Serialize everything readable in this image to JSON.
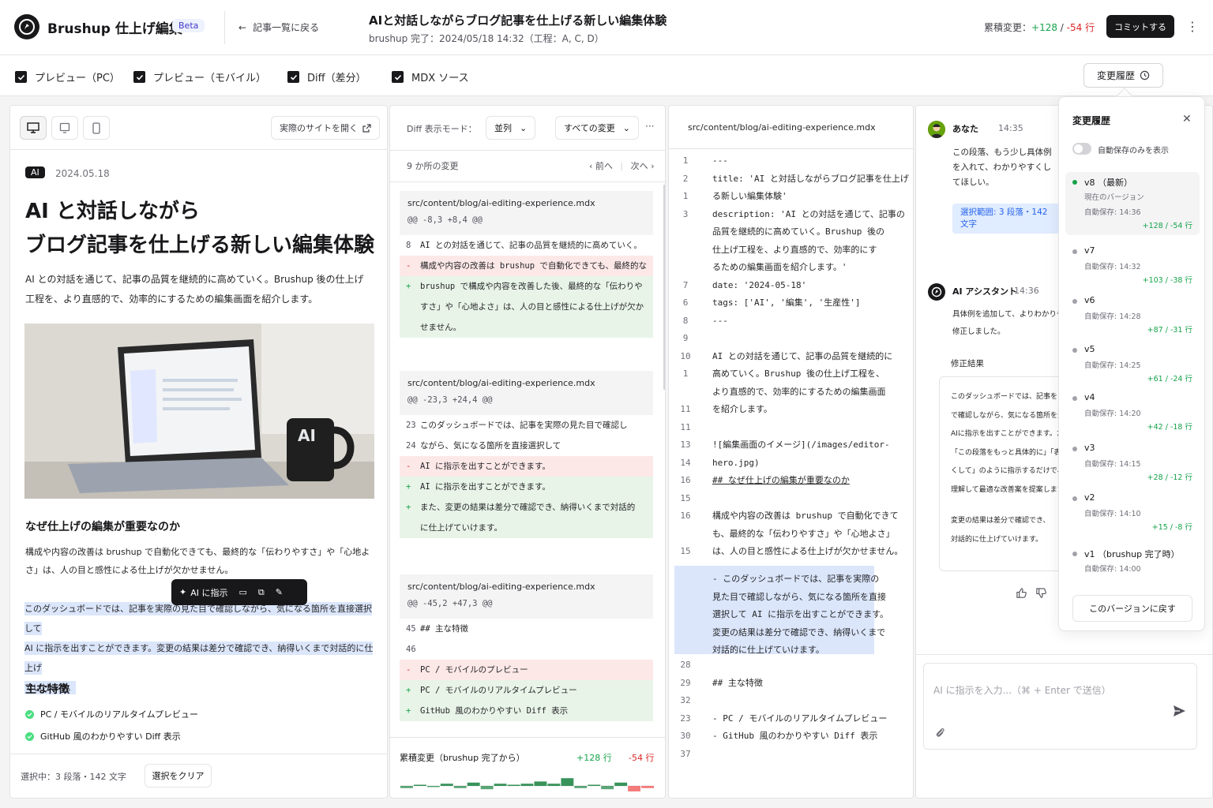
{
  "header": {
    "app_title": "Brushup 仕上げ編集",
    "beta": "Beta",
    "back_link": "記事一覧に戻る",
    "doc_title": "AIと対話しながらブログ記事を仕上げる新しい編集体験",
    "doc_subtitle": "brushup 完了：2024/05/18 14:32（工程：A, C, D）",
    "cumulative_label": "累積変更：",
    "cumulative_add": "+128",
    "cumulative_sep": " / ",
    "cumulative_del": "-54 行",
    "commit": "コミットする"
  },
  "toggles": {
    "pc": "プレビュー（PC）",
    "mobile": "プレビュー（モバイル）",
    "diff": "Diff（差分）",
    "mdx": "MDX ソース",
    "history_button": "変更履歴"
  },
  "preview": {
    "open_site": "実際のサイトを開く",
    "tag": "AI",
    "date": "2024.05.18",
    "title_line1": "AI と対話しながら",
    "title_line2": "ブログ記事を仕上げる新しい編集体験",
    "lead": "AI との対話を通じて、記事の品質を継続的に高めていく。Brushup 後の仕上げ工程を、より直感的で、効率的にするための編集画面を紹介します。",
    "image_text": "AI",
    "h2_why": "なぜ仕上げの編集が重要なのか",
    "para_why": "構成や内容の改善は brushup で自動化できても、最終的な「伝わりやすさ」や「心地よさ」は、人の目と感性による仕上げが欠かせません。",
    "selected_line1": "このダッシュボードでは、記事を実際の見た目で確認しながら、気になる箇所を直接選択して",
    "selected_line2": "AI に指示を出すことができます。変更の結果は差分で確認でき、納得いくまで対話的に仕上げ",
    "selected_line3": "ていけます。",
    "toolbar_ai": "AI に指示",
    "h2_features": "主な特徴",
    "feature1": "PC / モバイルのリアルタイムプレビュー",
    "feature2": "GitHub 風のわかりやすい Diff 表示",
    "selection_info": "選択中：3 段落・142 文字",
    "clear_selection": "選択をクリア"
  },
  "diff": {
    "mode_label": "Diff 表示モード：",
    "mode_value": "並列",
    "filter_value": "すべての変更",
    "more": "···",
    "change_count": "9 か所の変更",
    "prev": "前へ",
    "next": "次へ",
    "hunks": [
      {
        "file": "src/content/blog/ai-editing-experience.mdx",
        "range": "@@ -8,3 +8,4 @@",
        "lines": [
          {
            "g": "8",
            "t": "AI との対話を通じて、記事の品質を継続的に高めていく。"
          },
          {
            "g": "-",
            "t": "構成や内容の改善は brushup で自動化できても、最終的な"
          },
          {
            "g": "+",
            "t": "brushup で構成や内容を改善した後、最終的な「伝わりや"
          },
          {
            "g": "",
            "t": "すさ」や「心地よさ」は、人の目と感性による仕上げが欠か"
          },
          {
            "g": "",
            "t": "せません。"
          }
        ]
      },
      {
        "file": "src/content/blog/ai-editing-experience.mdx",
        "range": "@@ -23,3 +24,4 @@",
        "lines": [
          {
            "g": "23",
            "t": "このダッシュボードでは、記事を実際の見た目で確認し"
          },
          {
            "g": "24",
            "t": "ながら、気になる箇所を直接選択して"
          },
          {
            "g": "-",
            "t": "AI に指示を出すことができます。"
          },
          {
            "g": "+",
            "t": "AI に指示を出すことができます。"
          },
          {
            "g": "+",
            "t": "また、変更の結果は差分で確認でき、納得いくまで対話的"
          },
          {
            "g": "",
            "t": "に仕上げていけます。"
          }
        ]
      },
      {
        "file": "src/content/blog/ai-editing-experience.mdx",
        "range": "@@ -45,2 +47,3 @@",
        "lines": [
          {
            "g": "45",
            "t": "## 主な特徴"
          },
          {
            "g": "46",
            "t": ""
          },
          {
            "g": "-",
            "t": "PC / モバイルのプレビュー"
          },
          {
            "g": "+",
            "t": "PC / モバイルのリアルタイムプレビュー"
          },
          {
            "g": "+",
            "t": "GitHub 風のわかりやすい Diff 表示"
          }
        ]
      }
    ],
    "cumulative_label": "累積変更（brushup 完了から）",
    "cumulative_add": "+128 行",
    "cumulative_del": "-54 行",
    "spark_values": [
      -2,
      1,
      -1,
      2,
      -2,
      3,
      -3,
      2,
      1,
      2,
      4,
      2,
      7,
      -2,
      1,
      -3,
      3,
      -5,
      -2
    ]
  },
  "source": {
    "file_path": "src/content/blog/ai-editing-experience.mdx",
    "lines": [
      {
        "n": "1",
        "t": "---"
      },
      {
        "n": "2",
        "t": "title: 'AI と対話しながらブログ記事を仕上げ"
      },
      {
        "n": "1",
        "t": "る新しい編集体験'"
      },
      {
        "n": "3",
        "t": "description: 'AI との対話を通じて、記事の"
      },
      {
        "n": "",
        "t": "品質を継続的に高めていく。Brushup 後の"
      },
      {
        "n": "",
        "t": "仕上げ工程を、より直感的で、効率的にす"
      },
      {
        "n": "",
        "t": "るための編集画面を紹介します。'"
      },
      {
        "n": "7",
        "t": "date: '2024-05-18'"
      },
      {
        "n": "6",
        "t": "tags: ['AI', '編集', '生産性']"
      },
      {
        "n": "8",
        "t": "---"
      },
      {
        "n": "9",
        "t": ""
      },
      {
        "n": "10",
        "t": "AI との対話を通じて、記事の品質を継続的に"
      },
      {
        "n": "1",
        "t": "高めていく。Brushup 後の仕上げ工程を、"
      },
      {
        "n": "",
        "t": "より直感的で、効率的にするための編集画面"
      },
      {
        "n": "11",
        "t": "を紹介します。"
      },
      {
        "n": "11",
        "t": ""
      },
      {
        "n": "13",
        "t": "![編集画面のイメージ](/images/editor-"
      },
      {
        "n": "14",
        "t": "hero.jpg)"
      },
      {
        "n": "16",
        "t": "## なぜ仕上げの編集が重要なのか"
      },
      {
        "n": "15",
        "t": ""
      },
      {
        "n": "16",
        "t": "構成や内容の改善は brushup で自動化できて"
      },
      {
        "n": "",
        "t": "も、最終的な「伝わりやすさ」や「心地よさ」"
      },
      {
        "n": "15",
        "t": "は、人の目と感性による仕上げが欠かせません。"
      },
      {
        "n": "",
        "t": "- このダッシュボードでは、記事を実際の"
      },
      {
        "n": "",
        "t": "見た目で確認しながら、気になる箇所を直接"
      },
      {
        "n": "",
        "t": "選択して AI に指示を出すことができます。"
      },
      {
        "n": "",
        "t": "変更の結果は差分で確認でき、納得いくまで"
      },
      {
        "n": "",
        "t": "対話的に仕上げていけます。"
      },
      {
        "n": "28",
        "t": ""
      },
      {
        "n": "29",
        "t": "## 主な特徴"
      },
      {
        "n": "32",
        "t": ""
      },
      {
        "n": "23",
        "t": "- PC / モバイルのリアルタイムプレビュー"
      },
      {
        "n": "30",
        "t": "- GitHub 風のわかりやすい Diff 表示"
      },
      {
        "n": "37",
        "t": ""
      }
    ]
  },
  "chat": {
    "user_name": "あなた",
    "user_time": "14:35",
    "user_message": "この段落、もう少し具体例を入れて、わかりやすくしてほしい。",
    "user_scope": "選択範囲: 3 段落・142 文字",
    "ai_name": "AI アシスタント",
    "ai_time": "14:36",
    "ai_msg_line1": "具体例を追加して、よりわかりやすく",
    "ai_msg_line2": "修正しました。",
    "result_label": "修正結果",
    "result_lines": [
      "このダッシュボードでは、記事を",
      "で確認しながら、気になる箇所を選",
      "AIに指示を出すことができます。たと",
      "「この段落をもっと具体的に」「表現",
      "くして」のように指示するだけで、A",
      "理解して最適な改善案を提案します。",
      "",
      "変更の結果は差分で確認でき、",
      "対話的に仕上げていけます。"
    ],
    "input_placeholder": "AI に指示を入力...（⌘ + Enter で送信）"
  },
  "history": {
    "title": "変更履歴",
    "autosave_only": "自動保存のみを表示",
    "versions": [
      {
        "name": "v8 （最新）",
        "sub1": "現在のバージョン",
        "sub2": "自動保存: 14:36",
        "diff": "+128 / -54 行"
      },
      {
        "name": "v7",
        "sub1": "",
        "sub2": "自動保存: 14:32",
        "diff": "+103 / -38 行"
      },
      {
        "name": "v6",
        "sub1": "",
        "sub2": "自動保存: 14:28",
        "diff": "+87 / -31 行"
      },
      {
        "name": "v5",
        "sub1": "",
        "sub2": "自動保存: 14:25",
        "diff": "+61 / -24 行"
      },
      {
        "name": "v4",
        "sub1": "",
        "sub2": "自動保存: 14:20",
        "diff": "+42 / -18 行"
      },
      {
        "name": "v3",
        "sub1": "",
        "sub2": "自動保存: 14:15",
        "diff": "+28 / -12 行"
      },
      {
        "name": "v2",
        "sub1": "",
        "sub2": "自動保存: 14:10",
        "diff": "+15 / -8 行"
      },
      {
        "name": "v1 （brushup 完了時）",
        "sub1": "",
        "sub2": "自動保存: 14:00",
        "diff": ""
      }
    ],
    "revert": "このバージョンに戻す"
  }
}
